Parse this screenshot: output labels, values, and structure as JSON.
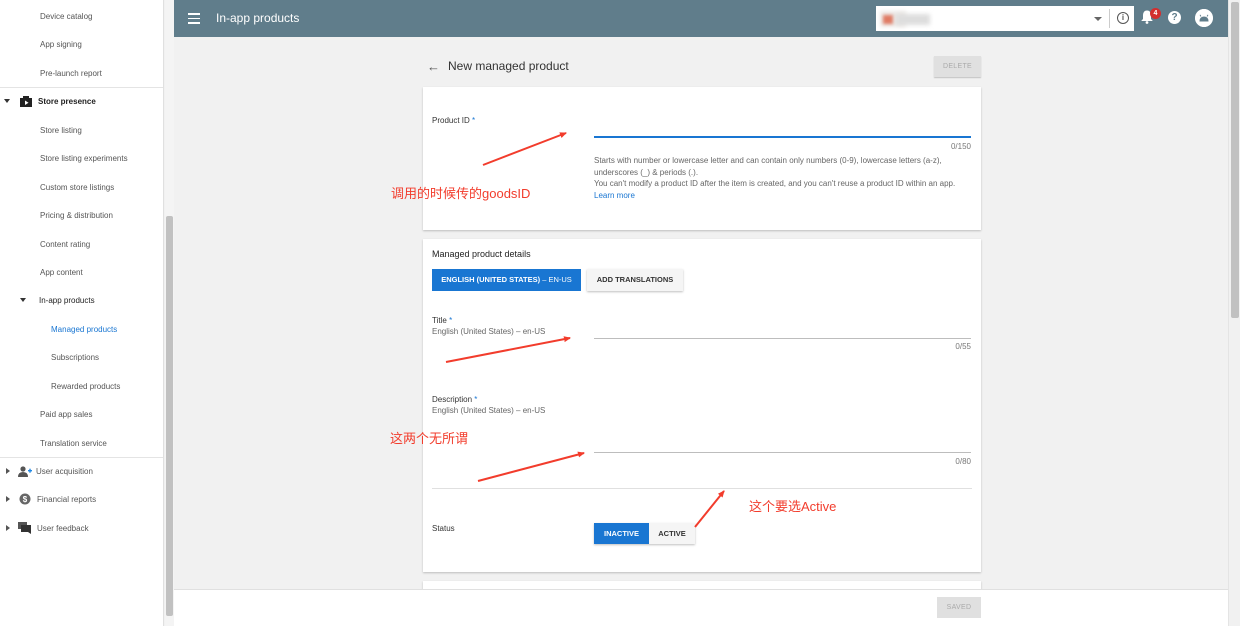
{
  "sidebar": {
    "items": [
      {
        "label": "Device catalog"
      },
      {
        "label": "App signing"
      },
      {
        "label": "Pre-launch report"
      },
      {
        "label": "Store presence"
      },
      {
        "label": "Store listing"
      },
      {
        "label": "Store listing experiments"
      },
      {
        "label": "Custom store listings"
      },
      {
        "label": "Pricing & distribution"
      },
      {
        "label": "Content rating"
      },
      {
        "label": "App content"
      },
      {
        "label": "In-app products"
      },
      {
        "label": "Managed products"
      },
      {
        "label": "Subscriptions"
      },
      {
        "label": "Rewarded products"
      },
      {
        "label": "Paid app sales"
      },
      {
        "label": "Translation service"
      },
      {
        "label": "User acquisition"
      },
      {
        "label": "Financial reports"
      },
      {
        "label": "User feedback"
      }
    ],
    "active_color": "#1976d2"
  },
  "header": {
    "title": "In-app products",
    "notification_count": "4",
    "bar_color": "#607d8b"
  },
  "page": {
    "heading": "New managed product",
    "delete_label": "DELETE",
    "saved_label": "SAVED"
  },
  "product_id": {
    "label": "Product ID",
    "required": "*",
    "value": "",
    "counter": "0/150",
    "help": [
      "Starts with number or lowercase letter and can contain only numbers (0-9), lowercase letters (a-z),",
      "underscores (_) & periods (.).",
      "You can't modify a product ID after the item is created, and you can't reuse a product ID within an app."
    ],
    "learn_more": "Learn more"
  },
  "details": {
    "section_title": "Managed product details",
    "lang_tab": "ENGLISH (UNITED STATES)",
    "lang_tab_suffix": "– EN-US",
    "add_translations": "ADD TRANSLATIONS",
    "title_field": {
      "label": "Title",
      "required": "*",
      "sub": "English (United States) – en-US",
      "value": "",
      "counter": "0/55"
    },
    "description_field": {
      "label": "Description",
      "required": "*",
      "sub": "English (United States) – en-US",
      "value": "",
      "counter": "0/80"
    },
    "status": {
      "label": "Status",
      "options": [
        "INACTIVE",
        "ACTIVE"
      ],
      "selected": "INACTIVE"
    }
  },
  "annotations": {
    "goods_id": "调用的时候传的goodsID",
    "whatever": "这两个无所谓",
    "choose_active": "这个要选Active",
    "color": "#f23c2c"
  }
}
